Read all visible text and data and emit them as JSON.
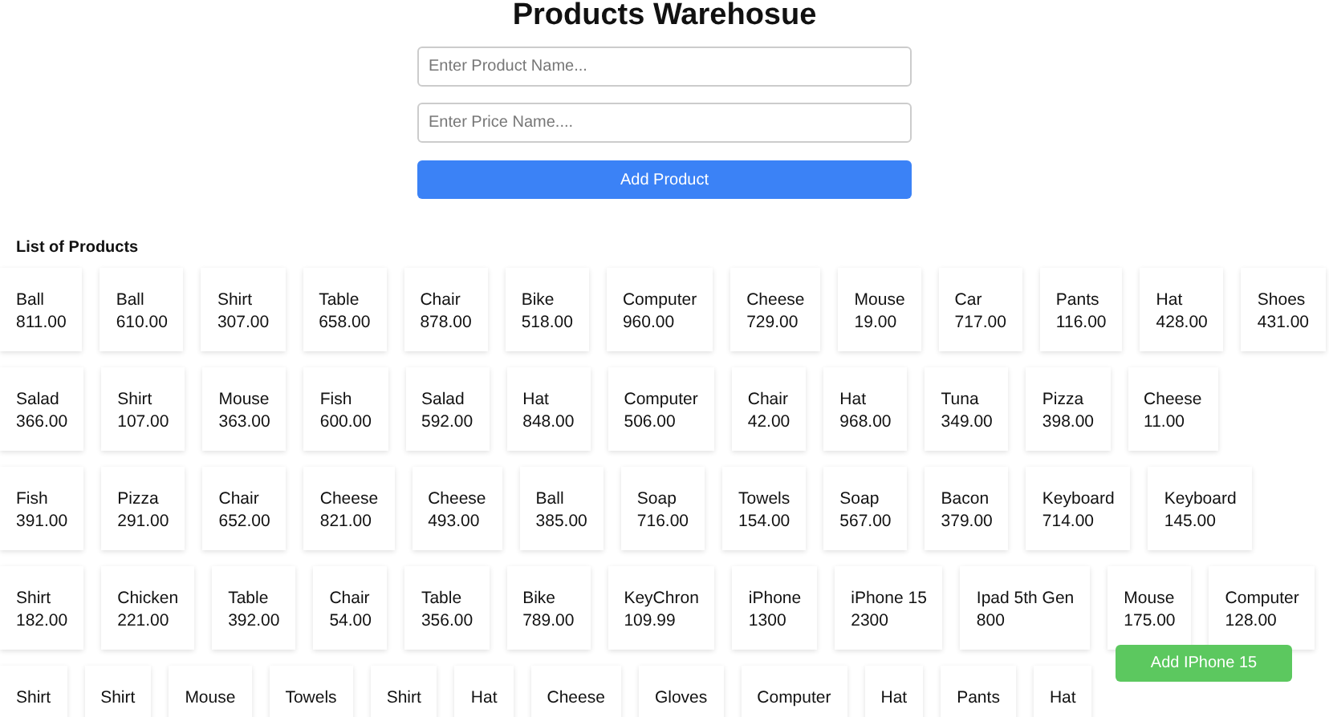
{
  "title": "Products Warehosue",
  "form": {
    "name_field": {
      "placeholder": "Enter Product Name..."
    },
    "price_field": {
      "placeholder": "Enter Price Name...."
    },
    "submit_button": "Add Product"
  },
  "list_heading": "List of Products",
  "product_rows": [
    [
      {
        "name": "Ball",
        "price": "811.00"
      },
      {
        "name": "Ball",
        "price": "610.00"
      },
      {
        "name": "Shirt",
        "price": "307.00"
      },
      {
        "name": "Table",
        "price": "658.00"
      },
      {
        "name": "Chair",
        "price": "878.00"
      },
      {
        "name": "Bike",
        "price": "518.00"
      },
      {
        "name": "Computer",
        "price": "960.00"
      },
      {
        "name": "Cheese",
        "price": "729.00"
      },
      {
        "name": "Mouse",
        "price": "19.00"
      },
      {
        "name": "Car",
        "price": "717.00"
      },
      {
        "name": "Pants",
        "price": "116.00"
      },
      {
        "name": "Hat",
        "price": "428.00"
      },
      {
        "name": "Shoes",
        "price": "431.00"
      }
    ],
    [
      {
        "name": "Salad",
        "price": "366.00"
      },
      {
        "name": "Shirt",
        "price": "107.00"
      },
      {
        "name": "Mouse",
        "price": "363.00"
      },
      {
        "name": "Fish",
        "price": "600.00"
      },
      {
        "name": "Salad",
        "price": "592.00"
      },
      {
        "name": "Hat",
        "price": "848.00"
      },
      {
        "name": "Computer",
        "price": "506.00"
      },
      {
        "name": "Chair",
        "price": "42.00"
      },
      {
        "name": "Hat",
        "price": "968.00"
      },
      {
        "name": "Tuna",
        "price": "349.00"
      },
      {
        "name": "Pizza",
        "price": "398.00"
      },
      {
        "name": "Cheese",
        "price": "11.00"
      }
    ],
    [
      {
        "name": "Fish",
        "price": "391.00"
      },
      {
        "name": "Pizza",
        "price": "291.00"
      },
      {
        "name": "Chair",
        "price": "652.00"
      },
      {
        "name": "Cheese",
        "price": "821.00"
      },
      {
        "name": "Cheese",
        "price": "493.00"
      },
      {
        "name": "Ball",
        "price": "385.00"
      },
      {
        "name": "Soap",
        "price": "716.00"
      },
      {
        "name": "Towels",
        "price": "154.00"
      },
      {
        "name": "Soap",
        "price": "567.00"
      },
      {
        "name": "Bacon",
        "price": "379.00"
      },
      {
        "name": "Keyboard",
        "price": "714.00"
      },
      {
        "name": "Keyboard",
        "price": "145.00"
      }
    ],
    [
      {
        "name": "Shirt",
        "price": "182.00"
      },
      {
        "name": "Chicken",
        "price": "221.00"
      },
      {
        "name": "Table",
        "price": "392.00"
      },
      {
        "name": "Chair",
        "price": "54.00"
      },
      {
        "name": "Table",
        "price": "356.00"
      },
      {
        "name": "Bike",
        "price": "789.00"
      },
      {
        "name": "KeyChron",
        "price": "109.99"
      },
      {
        "name": "iPhone",
        "price": "1300"
      },
      {
        "name": "iPhone 15",
        "price": "2300"
      },
      {
        "name": "Ipad 5th Gen",
        "price": "800"
      },
      {
        "name": "Mouse",
        "price": "175.00"
      },
      {
        "name": "Computer",
        "price": "128.00"
      }
    ],
    [
      {
        "name": "Shirt"
      },
      {
        "name": "Shirt"
      },
      {
        "name": "Mouse"
      },
      {
        "name": "Towels"
      },
      {
        "name": "Shirt"
      },
      {
        "name": "Hat"
      },
      {
        "name": "Cheese"
      },
      {
        "name": "Gloves"
      },
      {
        "name": "Computer"
      },
      {
        "name": "Hat"
      },
      {
        "name": "Pants"
      },
      {
        "name": "Hat"
      }
    ]
  ],
  "floating_button": "Add IPhone 15"
}
